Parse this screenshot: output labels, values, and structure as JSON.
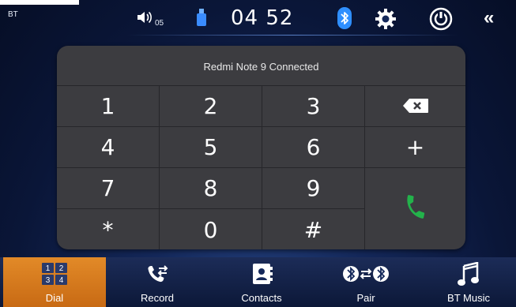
{
  "header": {
    "mode_label": "BT",
    "volume_level": "05",
    "clock": "04 52"
  },
  "dialer": {
    "status": "Redmi Note 9 Connected",
    "keys": [
      "1",
      "2",
      "3",
      "4",
      "5",
      "6",
      "7",
      "8",
      "9",
      "*",
      "0",
      "#"
    ],
    "plus_label": "+"
  },
  "tabs": [
    {
      "label": "Dial",
      "icon": "dialpad-icon",
      "active": true
    },
    {
      "label": "Record",
      "icon": "call-log-icon",
      "active": false
    },
    {
      "label": "Contacts",
      "icon": "contacts-icon",
      "active": false
    },
    {
      "label": "Pair",
      "icon": "bluetooth-pair-icon",
      "active": false
    },
    {
      "label": "BT Music",
      "icon": "music-note-icon",
      "active": false
    }
  ],
  "colors": {
    "active_tab": "#e28a28",
    "call_green": "#23b24b",
    "bluetooth_blue": "#2f8fff",
    "usb_blue": "#3a8cff"
  }
}
